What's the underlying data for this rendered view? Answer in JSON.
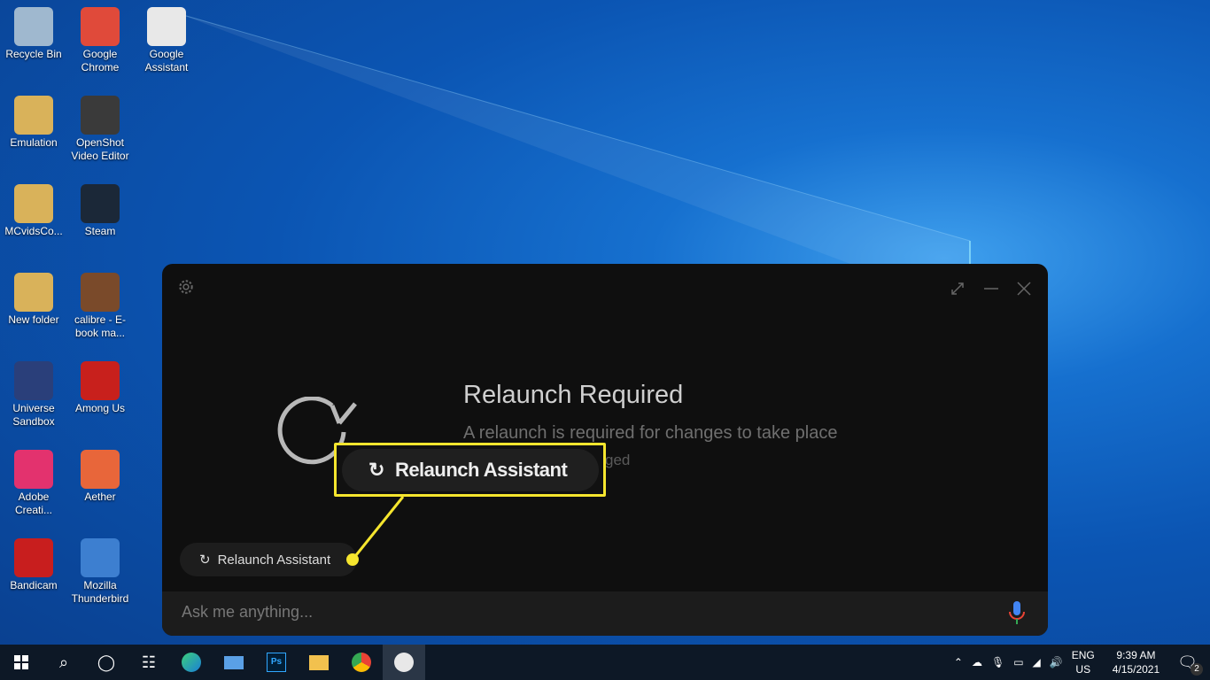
{
  "desktop": {
    "icons": [
      {
        "label": "Recycle Bin",
        "color": "#9fb8cf"
      },
      {
        "label": "Google Chrome",
        "color": "#e04a3a"
      },
      {
        "label": "Google Assistant",
        "color": "#e8e8e8"
      },
      {
        "label": "Emulation",
        "color": "#d9b25a"
      },
      {
        "label": "OpenShot Video Editor",
        "color": "#3a3a3a"
      },
      {
        "label": "MCvidsCo...",
        "color": "#d9b25a"
      },
      {
        "label": "Steam",
        "color": "#1b2838"
      },
      {
        "label": "New folder",
        "color": "#d9b25a"
      },
      {
        "label": "calibre - E-book ma...",
        "color": "#7a4a2a"
      },
      {
        "label": "Universe Sandbox",
        "color": "#2a3f7a"
      },
      {
        "label": "Among Us",
        "color": "#c8201c"
      },
      {
        "label": "Adobe Creati...",
        "color": "#e3326e"
      },
      {
        "label": "Aether",
        "color": "#e8663a"
      },
      {
        "label": "Bandicam",
        "color": "#c81e1e"
      },
      {
        "label": "Mozilla Thunderbird",
        "color": "#3d7fd0"
      }
    ]
  },
  "assistant": {
    "title": "Relaunch Required",
    "message": "A relaunch is required for changes to take place",
    "message_tail": "ged",
    "chip_label": "Relaunch Assistant",
    "input_placeholder": "Ask me anything..."
  },
  "callout": {
    "label": "Relaunch Assistant",
    "color": "#f5e52e"
  },
  "tray": {
    "lang1": "ENG",
    "lang2": "US",
    "time": "9:39 AM",
    "date": "4/15/2021",
    "notifications": "2"
  }
}
